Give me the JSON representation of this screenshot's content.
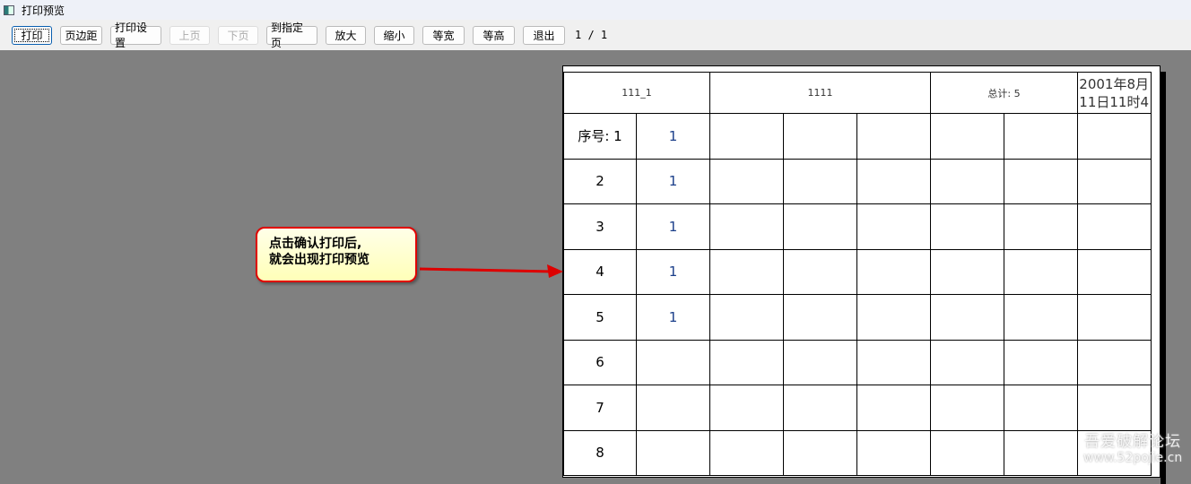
{
  "window": {
    "title": "打印预览"
  },
  "toolbar": {
    "buttons": [
      "打印",
      "页边距",
      "打印设置",
      "上页",
      "下页",
      "到指定页",
      "放大",
      "缩小",
      "等宽",
      "等高",
      "退出"
    ],
    "page_indicator": "1 / 1"
  },
  "report": {
    "header": {
      "c1": "111_1",
      "c2": "1111",
      "c3": "总计: 5",
      "c4": "2001年8月11日11时4"
    },
    "rows": [
      {
        "no": "序号: 1",
        "val": "1"
      },
      {
        "no": "2",
        "val": "1"
      },
      {
        "no": "3",
        "val": "1"
      },
      {
        "no": "4",
        "val": "1"
      },
      {
        "no": "5",
        "val": "1"
      },
      {
        "no": "6",
        "val": ""
      },
      {
        "no": "7",
        "val": ""
      },
      {
        "no": "8",
        "val": ""
      }
    ]
  },
  "callout": {
    "line1": "点击确认打印后,",
    "line2": "就会出现打印预览"
  },
  "watermark": {
    "line1": "吾爱破解论坛",
    "line2": "www.52pojie.cn"
  }
}
